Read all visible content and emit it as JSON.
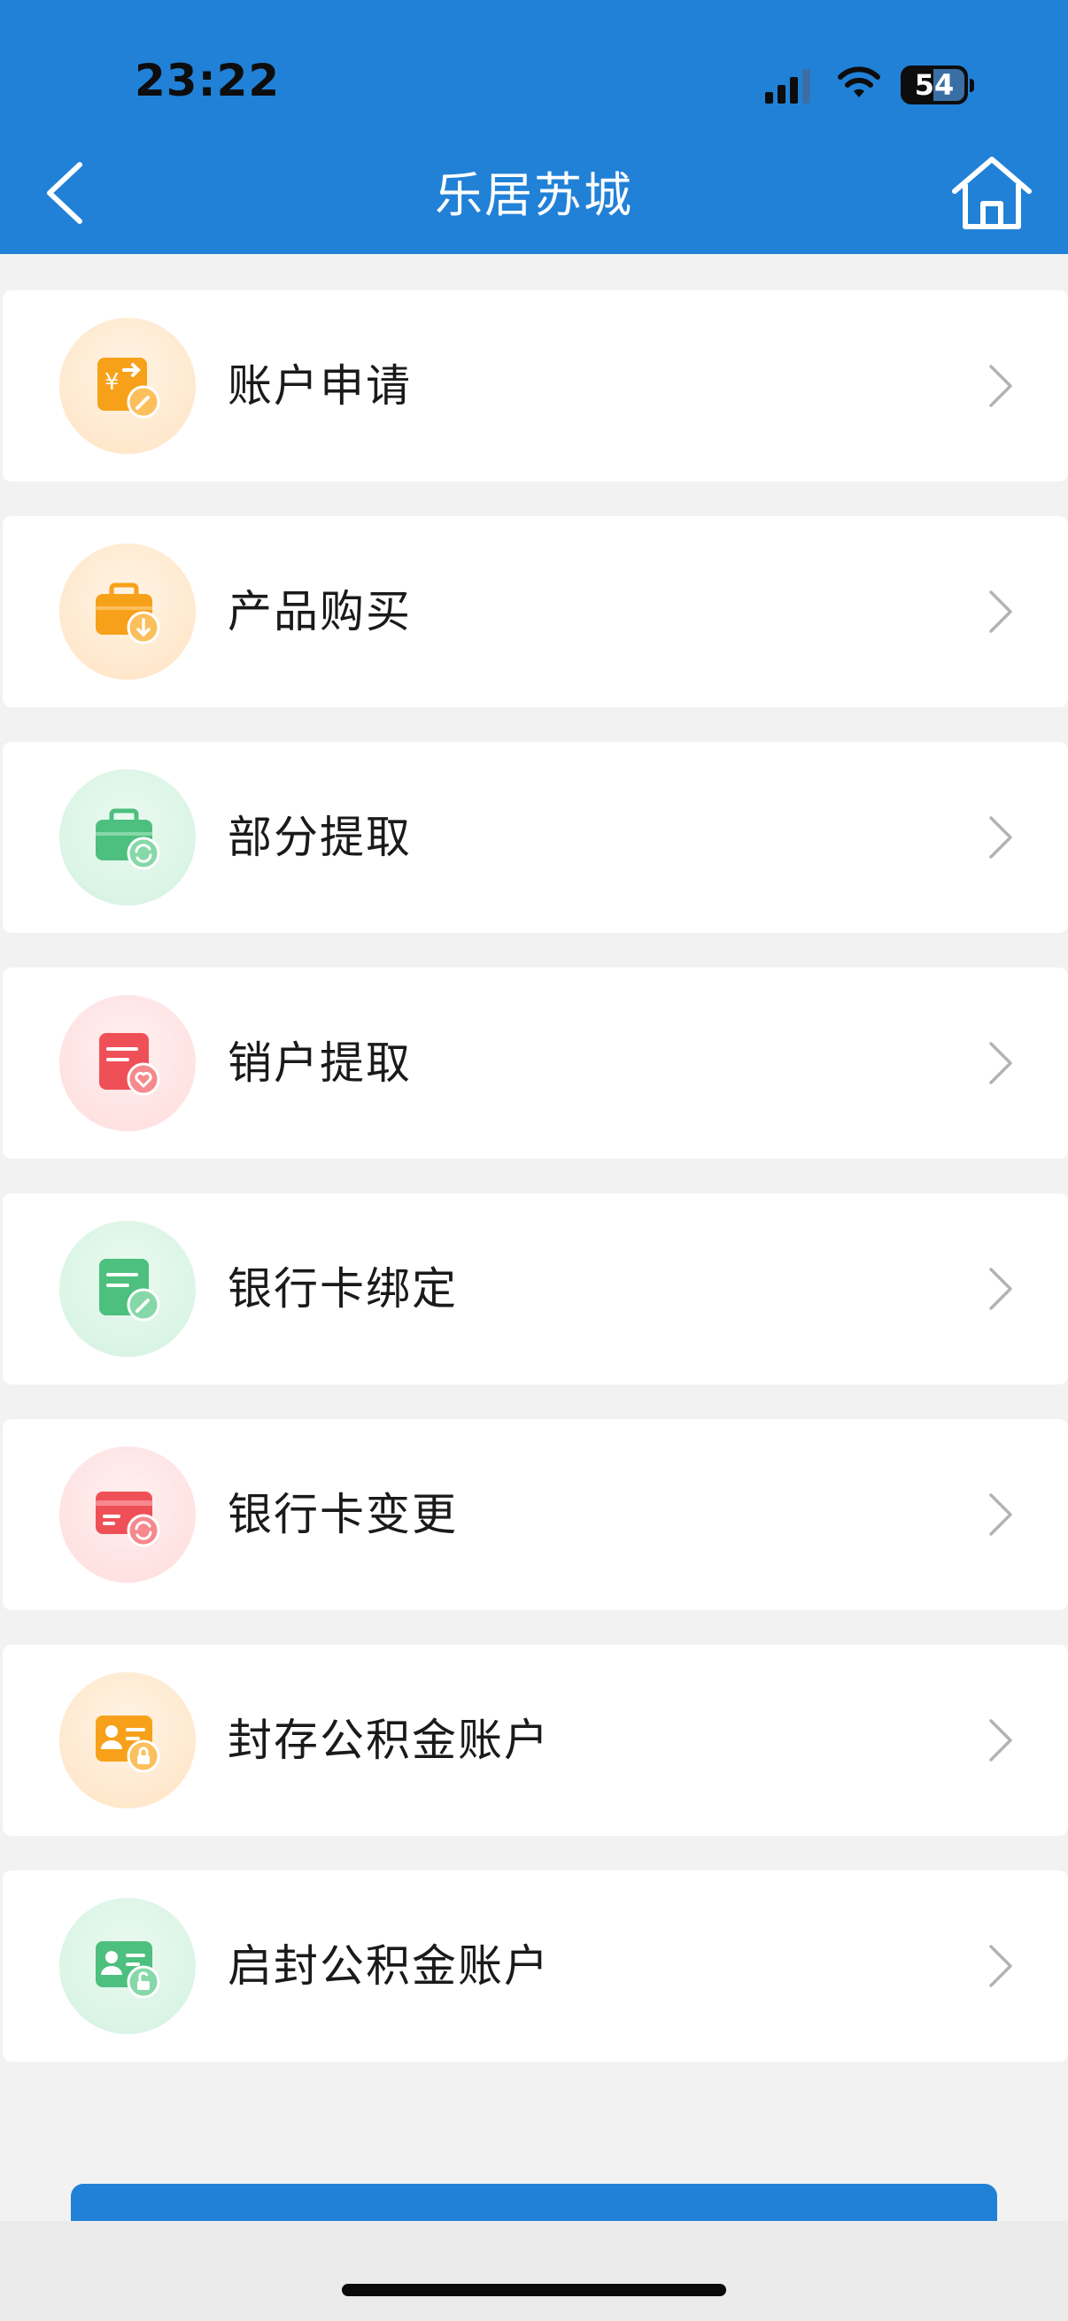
{
  "status_bar": {
    "time": "23:22",
    "battery": "54",
    "battery_level": 0.54
  },
  "nav": {
    "title": "乐居苏城"
  },
  "menu": [
    {
      "label": "账户申请",
      "icon": "account-apply-icon",
      "color": "#f7a11a"
    },
    {
      "label": "产品购买",
      "icon": "product-purchase-icon",
      "color": "#f7a11a"
    },
    {
      "label": "部分提取",
      "icon": "partial-withdraw-icon",
      "color": "#4dbf7e"
    },
    {
      "label": "销户提取",
      "icon": "close-account-withdraw-icon",
      "color": "#ef5057"
    },
    {
      "label": "银行卡绑定",
      "icon": "bank-card-bind-icon",
      "color": "#4dbf7e"
    },
    {
      "label": "银行卡变更",
      "icon": "bank-card-change-icon",
      "color": "#ef5057"
    },
    {
      "label": "封存公积金账户",
      "icon": "seal-fund-account-icon",
      "color": "#f7a11a"
    },
    {
      "label": "启封公积金账户",
      "icon": "unseal-fund-account-icon",
      "color": "#4dbf7e"
    }
  ],
  "colors": {
    "accent": "#2181d7",
    "background": "#f2f2f2",
    "orange": "#f7a11a",
    "green": "#4dbf7e",
    "red": "#ef5057"
  }
}
